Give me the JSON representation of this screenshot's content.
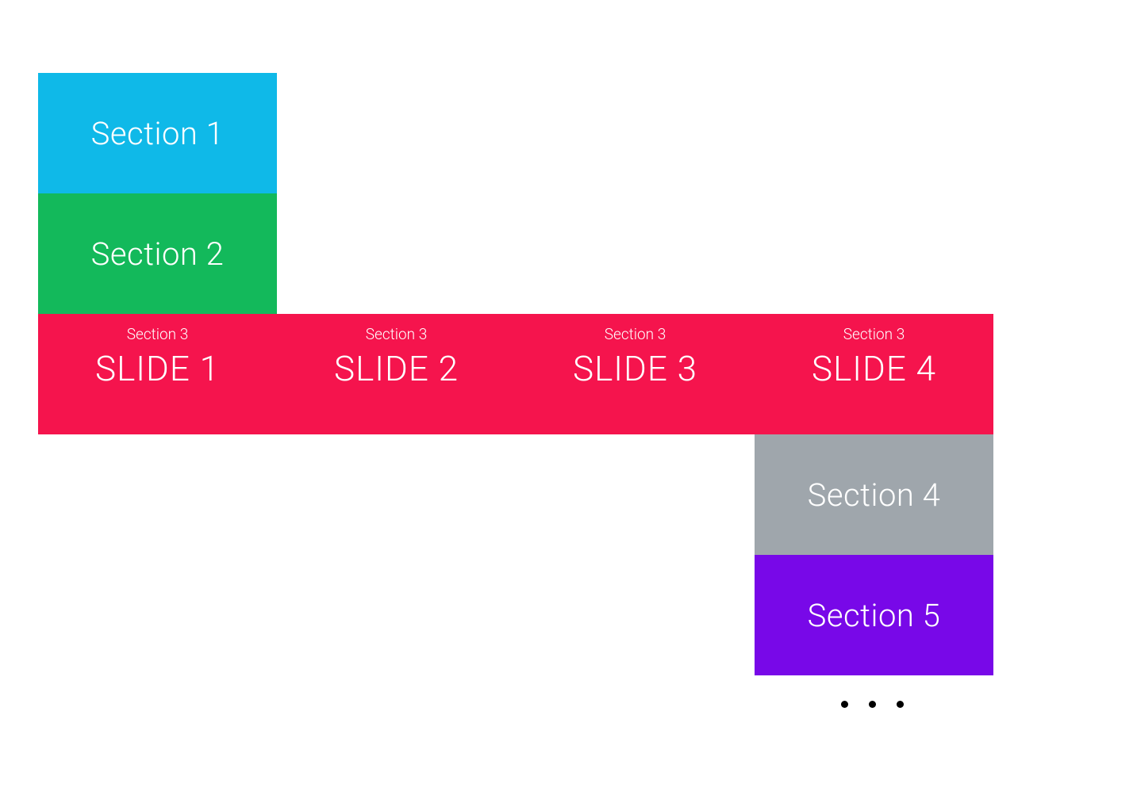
{
  "sections": {
    "s1": {
      "title": "Section 1",
      "color": "#0fb9e8"
    },
    "s2": {
      "title": "Section 2",
      "color": "#13b95b"
    },
    "s3": {
      "label": "Section 3",
      "color": "#f5144d",
      "slides": [
        {
          "title": "SLIDE 1"
        },
        {
          "title": "SLIDE 2"
        },
        {
          "title": "SLIDE 3"
        },
        {
          "title": "SLIDE 4"
        }
      ]
    },
    "s4": {
      "title": "Section 4",
      "color": "#9fa6ac"
    },
    "s5": {
      "title": "Section 5",
      "color": "#7808e8"
    }
  },
  "pagination": {
    "dot_count": 3
  }
}
